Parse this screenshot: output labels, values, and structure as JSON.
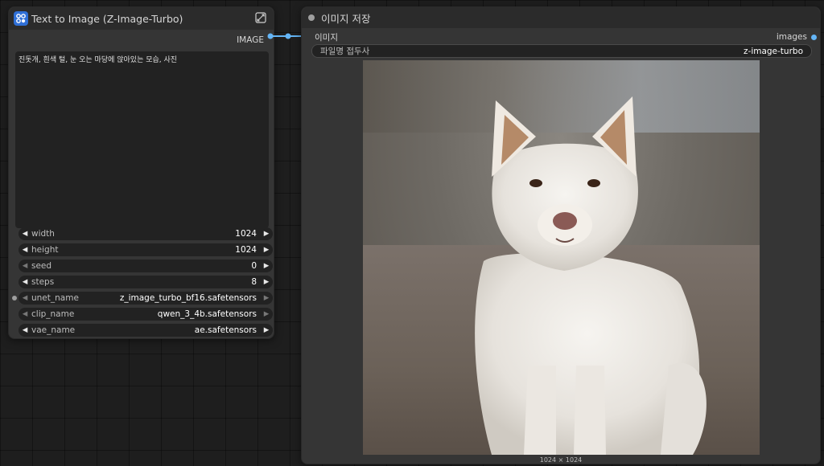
{
  "left_node": {
    "title": "Text to Image (Z-Image-Turbo)",
    "output_label": "IMAGE",
    "prompt": "진돗개, 흰색 털, 눈 오는 마당에 앉아있는 모습, 사진",
    "widgets": [
      {
        "label": "width",
        "value": "1024"
      },
      {
        "label": "height",
        "value": "1024"
      },
      {
        "label": "seed",
        "value": "0"
      },
      {
        "label": "steps",
        "value": "8"
      },
      {
        "label": "unet_name",
        "value": "z_image_turbo_bf16.safetensors"
      },
      {
        "label": "clip_name",
        "value": "qwen_3_4b.safetensors"
      },
      {
        "label": "vae_name",
        "value": "ae.safetensors"
      }
    ]
  },
  "right_node": {
    "title": "이미지 저장",
    "input_label": "이미지",
    "output_label": "images",
    "prefix_label": "파일명 접두사",
    "prefix_value": "z-image-turbo",
    "image_dimensions": "1024 × 1024"
  },
  "colors": {
    "link": "#64b5f6",
    "canvas": "#1e1e1e",
    "node": "#353535",
    "widget": "#222222"
  },
  "icons": {
    "app": "node-graph-icon",
    "expand": "expand-icon",
    "arrow_left": "triangle-left-icon",
    "arrow_right": "triangle-right-icon"
  }
}
